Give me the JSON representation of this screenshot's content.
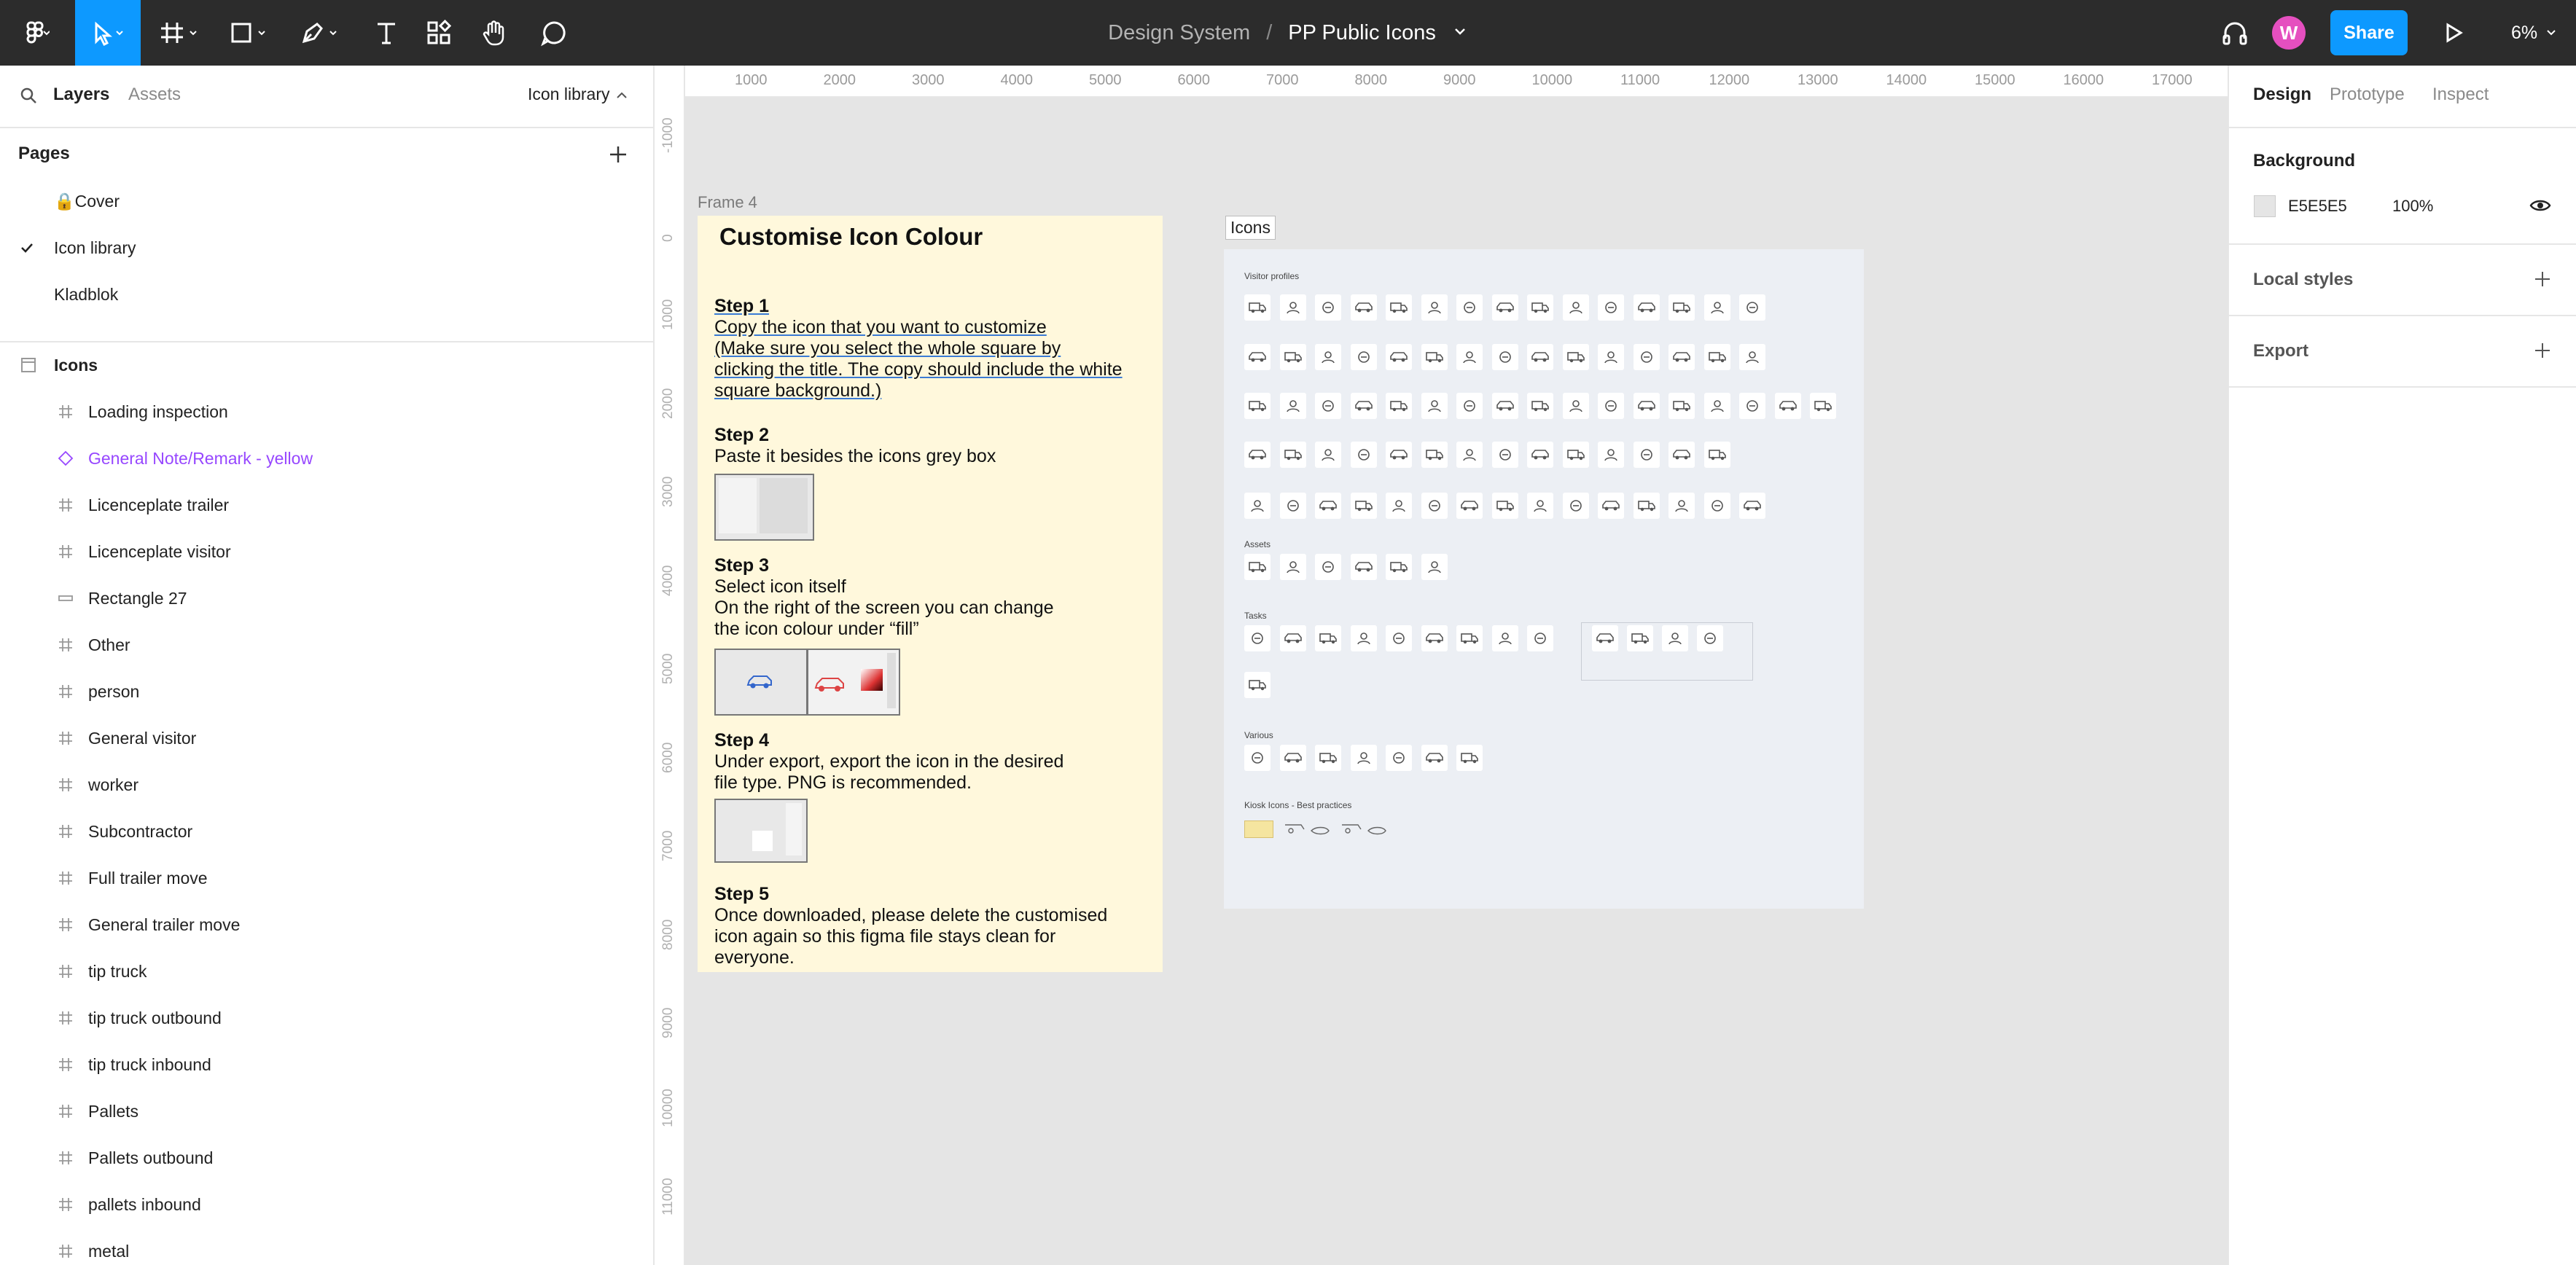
{
  "topbar": {
    "project": "Design System",
    "separator": "/",
    "file": "PP Public Icons",
    "avatar_initial": "W",
    "share_label": "Share",
    "zoom": "6%"
  },
  "left": {
    "tabs": {
      "layers": "Layers",
      "assets": "Assets"
    },
    "page_selector": "Icon library",
    "pages_title": "Pages",
    "pages": [
      {
        "label": "🔒Cover",
        "current": false
      },
      {
        "label": "Icon library",
        "current": true
      },
      {
        "label": "Kladblok",
        "current": false
      }
    ],
    "frame_name": "Icons",
    "layers": [
      {
        "label": "Loading inspection",
        "icon": "frame-icon"
      },
      {
        "label": "General Note/Remark - yellow",
        "icon": "component-icon"
      },
      {
        "label": "Licenceplate trailer",
        "icon": "frame-icon"
      },
      {
        "label": "Licenceplate visitor",
        "icon": "frame-icon"
      },
      {
        "label": "Rectangle 27",
        "icon": "rectangle-icon"
      },
      {
        "label": "Other",
        "icon": "frame-icon"
      },
      {
        "label": "person",
        "icon": "frame-icon"
      },
      {
        "label": "General visitor",
        "icon": "frame-icon"
      },
      {
        "label": "worker",
        "icon": "frame-icon"
      },
      {
        "label": "Subcontractor",
        "icon": "frame-icon"
      },
      {
        "label": "Full trailer move",
        "icon": "frame-icon"
      },
      {
        "label": "General trailer move",
        "icon": "frame-icon"
      },
      {
        "label": "tip truck",
        "icon": "frame-icon"
      },
      {
        "label": "tip truck outbound",
        "icon": "frame-icon"
      },
      {
        "label": "tip truck inbound",
        "icon": "frame-icon"
      },
      {
        "label": "Pallets",
        "icon": "frame-icon"
      },
      {
        "label": "Pallets outbound",
        "icon": "frame-icon"
      },
      {
        "label": "pallets inbound",
        "icon": "frame-icon"
      },
      {
        "label": "metal",
        "icon": "frame-icon"
      }
    ]
  },
  "right": {
    "tabs": {
      "design": "Design",
      "prototype": "Prototype",
      "inspect": "Inspect"
    },
    "background_title": "Background",
    "background_hex": "E5E5E5",
    "background_color": "#E5E5E5",
    "background_opacity": "100%",
    "local_styles": "Local styles",
    "export": "Export"
  },
  "canvas": {
    "ruler_top": [
      "1000",
      "2000",
      "3000",
      "4000",
      "5000",
      "6000",
      "7000",
      "8000",
      "9000",
      "10000",
      "11000",
      "12000",
      "13000",
      "14000",
      "15000",
      "16000",
      "17000"
    ],
    "ruler_left": [
      "-1000",
      "0",
      "1000",
      "2000",
      "3000",
      "4000",
      "5000",
      "6000",
      "7000",
      "8000",
      "9000",
      "10000",
      "11000",
      "00"
    ],
    "frame4_label": "Frame 4",
    "frame4": {
      "title": "Customise Icon Colour",
      "step1_title": "Step 1",
      "step1_lines": [
        "Copy the icon that you want to customize",
        "(Make sure you select the whole square by",
        "clicking the title. The copy should include the white",
        "square background.)"
      ],
      "step2_title": "Step 2",
      "step2_lines": [
        "Paste it besides the icons grey box"
      ],
      "step3_title": "Step 3",
      "step3_lines": [
        "Select icon itself",
        "On the right of the screen you can change",
        "the icon colour under “fill”"
      ],
      "step4_title": "Step 4",
      "step4_lines": [
        "Under export, export the icon in the desired",
        "file type. PNG is recommended."
      ],
      "step5_title": "Step 5",
      "step5_lines": [
        "Once downloaded, please delete the customised",
        "icon again so this figma file stays clean for",
        "everyone."
      ]
    },
    "icons_label": "Icons",
    "icons_sections": {
      "visitor": "Visitor profiles",
      "assets": "Assets",
      "tasks": "Tasks",
      "various": "Various",
      "kiosk": "Kiosk Icons - Best practices"
    },
    "accent_color": "#0D99FF",
    "help_label": "?"
  }
}
